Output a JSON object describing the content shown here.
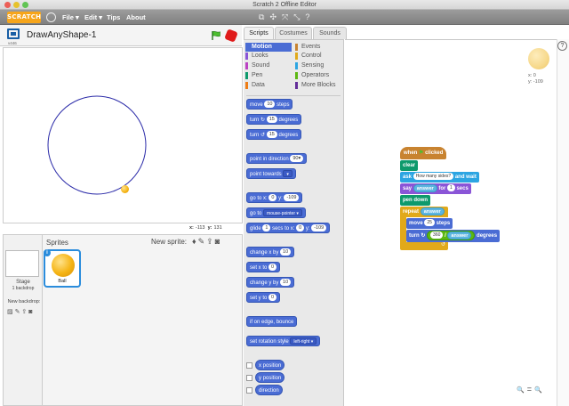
{
  "window": {
    "title": "Scratch 2 Offline Editor"
  },
  "menu": {
    "logo": "SCRATCH",
    "file": "File ▾",
    "edit": "Edit ▾",
    "tips": "Tips",
    "about": "About"
  },
  "stage": {
    "project_title": "DrawAnyShape-1",
    "version": "v446",
    "coord_x_label": "x:",
    "coord_x": "-113",
    "coord_y_label": "y:",
    "coord_y": "131"
  },
  "sprites": {
    "header": "Sprites",
    "new_sprite": "New sprite:",
    "stage_label": "Stage",
    "stage_backdrops": "1 backdrop",
    "new_backdrop": "New backdrop:",
    "items": [
      {
        "name": "Ball"
      }
    ]
  },
  "tabs": {
    "scripts": "Scripts",
    "costumes": "Costumes",
    "sounds": "Sounds"
  },
  "categories": {
    "left": [
      {
        "name": "Motion",
        "color": "#4a6cd4"
      },
      {
        "name": "Looks",
        "color": "#8a55d7"
      },
      {
        "name": "Sound",
        "color": "#bb42c3"
      },
      {
        "name": "Pen",
        "color": "#0e9a6c"
      },
      {
        "name": "Data",
        "color": "#ee7d16"
      }
    ],
    "right": [
      {
        "name": "Events",
        "color": "#c88330"
      },
      {
        "name": "Control",
        "color": "#e1a91a"
      },
      {
        "name": "Sensing",
        "color": "#2ca5e2"
      },
      {
        "name": "Operators",
        "color": "#5cb712"
      },
      {
        "name": "More Blocks",
        "color": "#632d99"
      }
    ]
  },
  "palette": {
    "move": {
      "pre": "move",
      "val": "10",
      "post": "steps"
    },
    "turn_cw": {
      "pre": "turn",
      "val": "15",
      "post": "degrees"
    },
    "turn_ccw": {
      "pre": "turn",
      "val": "15",
      "post": "degrees"
    },
    "point_dir": {
      "pre": "point in direction",
      "val": "90▾"
    },
    "point_towards": {
      "pre": "point towards",
      "val": "▾"
    },
    "goto_xy": {
      "pre": "go to x:",
      "x": "0",
      "mid": "y:",
      "y": "-109"
    },
    "goto": {
      "pre": "go to",
      "val": "mouse-pointer ▾"
    },
    "glide": {
      "pre": "glide",
      "secs": "1",
      "mid1": "secs to x:",
      "x": "0",
      "mid2": "y:",
      "y": "-109"
    },
    "change_x": {
      "pre": "change x by",
      "val": "10"
    },
    "set_x": {
      "pre": "set x to",
      "val": "0"
    },
    "change_y": {
      "pre": "change y by",
      "val": "10"
    },
    "set_y": {
      "pre": "set y to",
      "val": "0"
    },
    "bounce": {
      "text": "if on edge, bounce"
    },
    "rotation": {
      "pre": "set rotation style",
      "val": "left-right ▾"
    },
    "rep_x": "x position",
    "rep_y": "y position",
    "rep_dir": "direction"
  },
  "script": {
    "hat": {
      "pre": "when",
      "post": "clicked"
    },
    "clear": "clear",
    "ask": {
      "pre": "ask",
      "val": "How many sides?",
      "post": "and wait"
    },
    "say": {
      "pre": "say",
      "rep": "answer",
      "mid": "for",
      "val": "1",
      "post": "secs"
    },
    "pen_down": "pen down",
    "repeat": {
      "pre": "repeat",
      "rep": "answer"
    },
    "move": {
      "pre": "move",
      "val": "25",
      "post": "steps"
    },
    "turn": {
      "pre": "turn",
      "val1": "360",
      "op": "/",
      "rep": "answer",
      "post": "degrees"
    }
  },
  "script_area": {
    "sprite_x": "x: 0",
    "sprite_y": "y: -109"
  },
  "zoom": {
    "out": "🔍",
    "reset": "=",
    "in": "🔍"
  },
  "colors": {
    "motion": "#4a6cd4",
    "looks": "#8a55d7",
    "pen": "#0e9a6c",
    "control": "#e1a91a",
    "events": "#c88330",
    "sensing": "#2ca5e2",
    "operators": "#5cb712",
    "circle": "#2a2aa8",
    "ball": "#f5b414"
  }
}
